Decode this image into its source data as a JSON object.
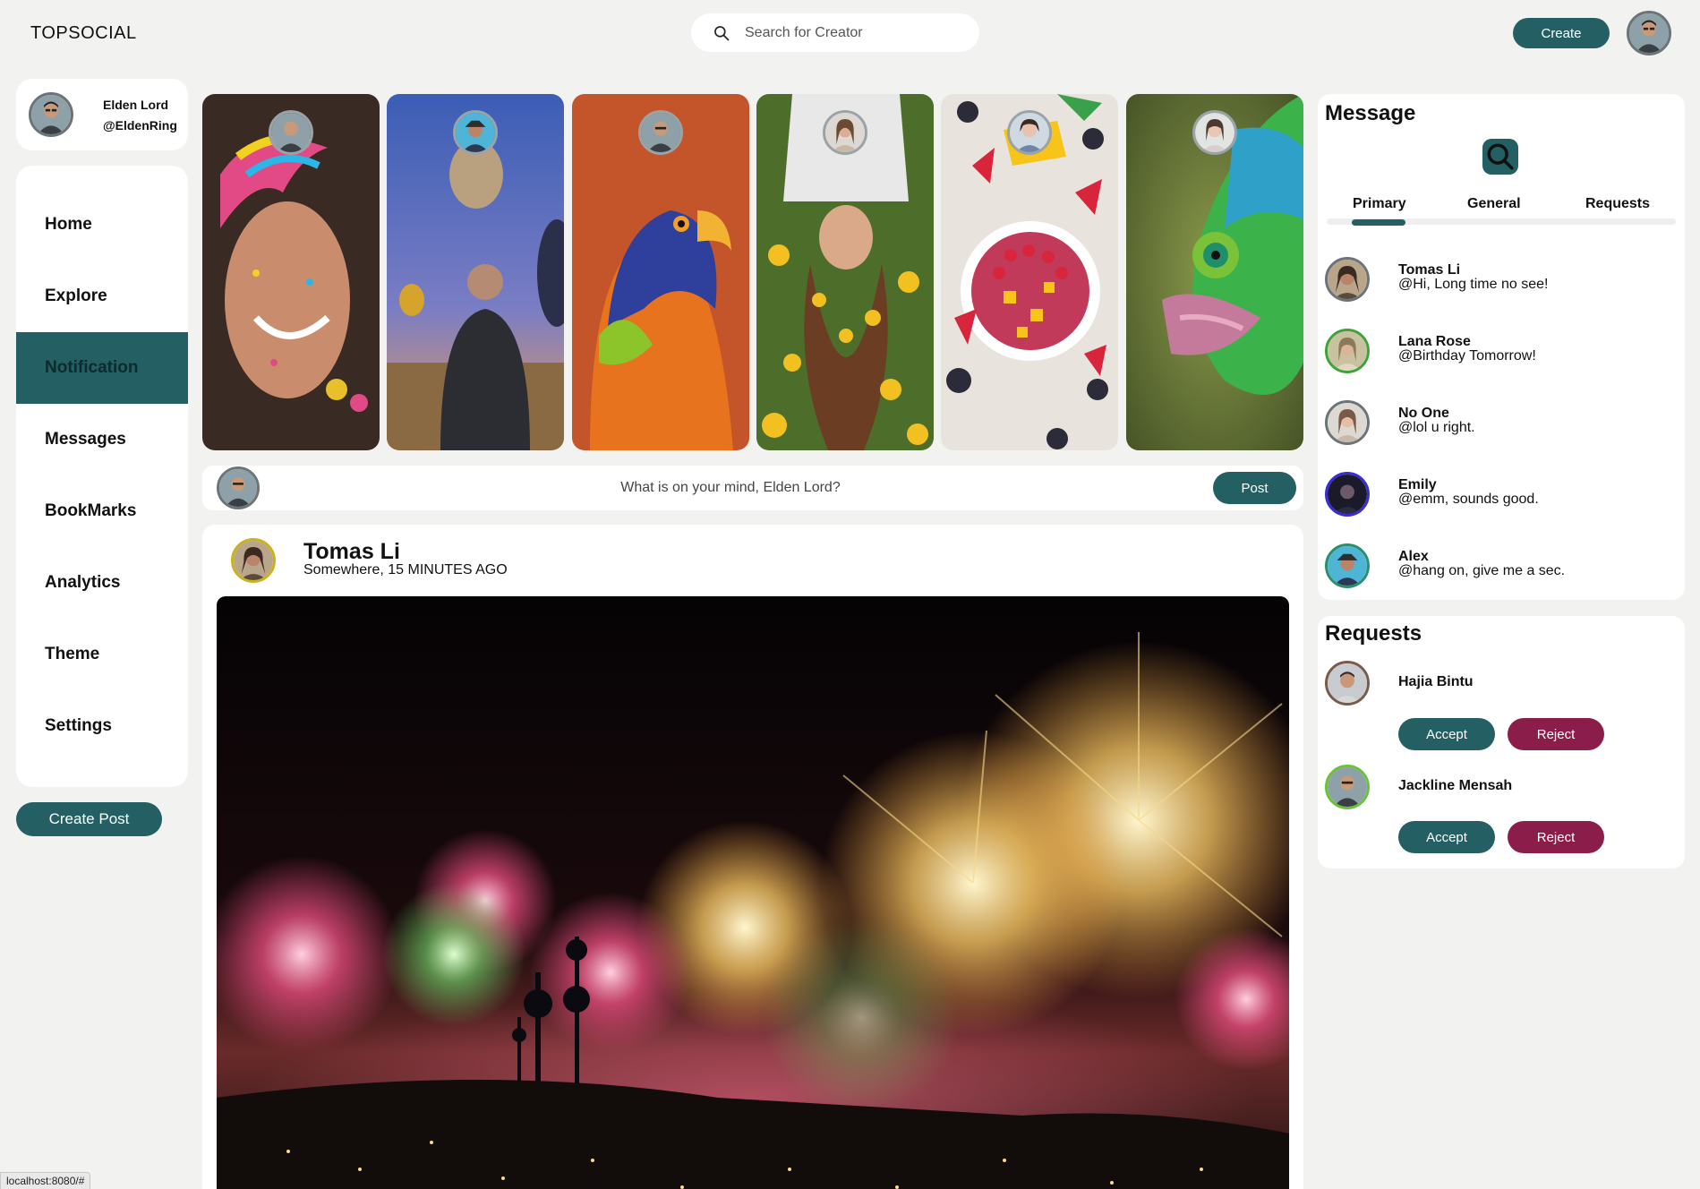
{
  "app": {
    "brand": "TOPSOCIAL",
    "search_placeholder": "Search for Creator",
    "create_label": "Create"
  },
  "profile": {
    "name": "Elden Lord",
    "handle": "@EldenRing"
  },
  "sidebar": {
    "items": [
      {
        "label": "Home"
      },
      {
        "label": "Explore"
      },
      {
        "label": "Notification",
        "active": true
      },
      {
        "label": "Messages"
      },
      {
        "label": "BookMarks"
      },
      {
        "label": "Analytics"
      },
      {
        "label": "Theme"
      },
      {
        "label": "Settings"
      }
    ],
    "create_post_label": "Create Post"
  },
  "stories": [
    {
      "name": "story-rainbow-face",
      "colors": [
        "#3a2a24",
        "#c98d6d",
        "#f0b27a"
      ]
    },
    {
      "name": "story-hot-air-balloons",
      "colors": [
        "#3b5db5",
        "#7a7dc4",
        "#e89a5a"
      ]
    },
    {
      "name": "story-parrot",
      "colors": [
        "#c4552a",
        "#2e3f9c",
        "#e8731f"
      ]
    },
    {
      "name": "story-woman-flowers",
      "colors": [
        "#4d6e2a",
        "#f2c020",
        "#6b3d22"
      ]
    },
    {
      "name": "story-fruit-bowl",
      "colors": [
        "#e8e4dd",
        "#d9253b",
        "#f7c41a"
      ]
    },
    {
      "name": "story-chameleon",
      "colors": [
        "#6b7d3a",
        "#2fa0c8",
        "#3bb34a"
      ]
    }
  ],
  "composer": {
    "placeholder": "What is on your mind, Elden Lord?",
    "post_label": "Post"
  },
  "feed_post": {
    "author": "Tomas Li",
    "meta": "Somewhere, 15 MINUTES AGO",
    "image": "fireworks-over-city"
  },
  "messages": {
    "title": "Message",
    "tabs": [
      "Primary",
      "General",
      "Requests"
    ],
    "active_tab": "Primary",
    "items": [
      {
        "name": "Tomas Li",
        "text": "@Hi, Long time no see!",
        "ring": "#6b7478"
      },
      {
        "name": "Lana Rose",
        "text": "@Birthday Tomorrow!",
        "ring": "#3fa33a"
      },
      {
        "name": "No One",
        "text": "@lol u right.",
        "ring": "#6b7478"
      },
      {
        "name": "Emily",
        "text": "@emm, sounds good.",
        "ring": "#3a2bd6"
      },
      {
        "name": "Alex",
        "text": "@hang on, give me a sec.",
        "ring": "#2a8f6a"
      }
    ]
  },
  "requests": {
    "title": "Requests",
    "items": [
      {
        "name": "Hajia Bintu",
        "accept": "Accept",
        "reject": "Reject"
      },
      {
        "name": "Jackline Mensah",
        "accept": "Accept",
        "reject": "Reject"
      }
    ]
  },
  "status_bar": {
    "url": "localhost:8080/#"
  },
  "colors": {
    "accent": "#235f63",
    "reject": "#8a1d4a",
    "background": "#f2f2f0"
  }
}
